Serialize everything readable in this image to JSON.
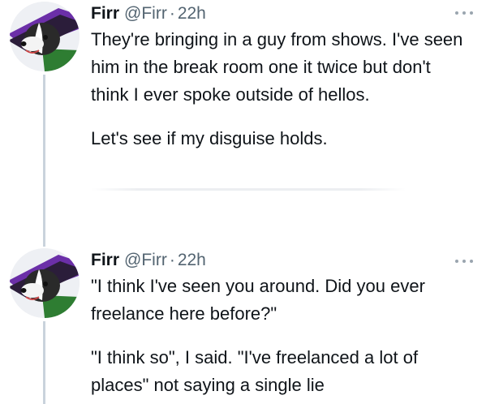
{
  "tweets": [
    {
      "author_name": "Firr",
      "author_handle": "@Firr",
      "separator": "·",
      "time": "22h",
      "paragraphs": [
        "They're bringing in a guy from shows.  I've seen him in the break room one it twice but don't think I ever spoke outside of hellos.",
        "Let's see if my disguise holds."
      ]
    },
    {
      "author_name": "Firr",
      "author_handle": "@Firr",
      "separator": "·",
      "time": "22h",
      "paragraphs": [
        "\"I think I've seen you around.  Did you ever freelance here before?\"",
        "\"I think so\", I said. \"I've freelanced a lot of places\" not saying a single lie"
      ]
    }
  ],
  "icons": {
    "avatar": "skunk-avatar-icon",
    "more": "more-options-icon"
  },
  "colors": {
    "text": "#0f1419",
    "secondary_text": "#536471",
    "thread_line": "#c9d3dc"
  }
}
